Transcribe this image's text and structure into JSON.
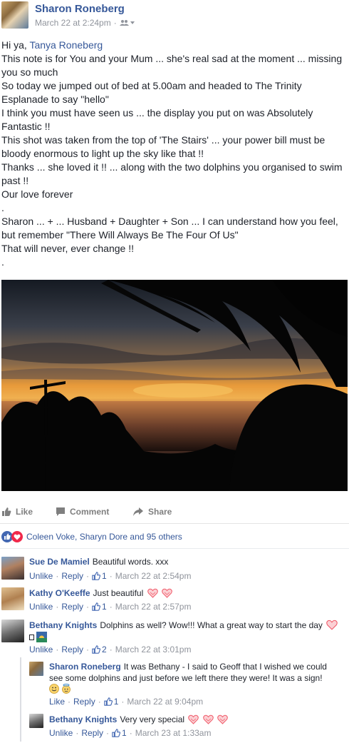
{
  "post": {
    "author": "Sharon Roneberg",
    "date": "March 22 at 2:24pm",
    "audience_icon": "friends-icon",
    "lines": [
      {
        "prefix": "Hi ya, ",
        "mention": "Tanya Roneberg"
      },
      {
        "text": "This note is for You and your Mum ... she's real sad at the moment ... missing"
      },
      {
        "text": "you so much"
      },
      {
        "text": "So today we jumped out of bed at 5.00am and headed to The Trinity"
      },
      {
        "text": "Esplanade to say \"hello\""
      },
      {
        "text": "I think you must have seen us ... the display you put on was Absolutely"
      },
      {
        "text": "Fantastic !!"
      },
      {
        "text": "This shot was taken from the top of 'The Stairs' ... your power bill must be"
      },
      {
        "text": "bloody enormous to light up the sky like that !!"
      },
      {
        "text": "Thanks ... she loved it !! ... along with the two dolphins you organised to swim"
      },
      {
        "text": "past !!"
      },
      {
        "text": "Our love forever"
      },
      {
        "text": "."
      },
      {
        "text": "Sharon ... + ... Husband + Daughter + Son ... I can understand how you feel,"
      },
      {
        "text": "but remember \"There Will Always Be The Four Of Us\""
      },
      {
        "text": "That will never, ever change !!"
      },
      {
        "text": "."
      }
    ]
  },
  "actions": {
    "like": "Like",
    "comment": "Comment",
    "share": "Share"
  },
  "reactions": {
    "summary": "Coleen Voke, Sharyn Dore and 95 others"
  },
  "comments": [
    {
      "name": "Sue De Mamiel",
      "text": "Beautiful words. xxx",
      "hearts": 0,
      "unlike": "Unlike",
      "reply": "Reply",
      "likes": "1",
      "time": "March 22 at 2:54pm"
    },
    {
      "name": "Kathy O'Keeffe",
      "text": "Just beautiful",
      "hearts": 2,
      "unlike": "Unlike",
      "reply": "Reply",
      "likes": "1",
      "time": "March 22 at 2:57pm"
    },
    {
      "name": "Bethany Knights",
      "text": "Dolphins as well? Wow!!! What a great way to start the day",
      "hearts": 1,
      "unlike": "Unlike",
      "reply": "Reply",
      "likes": "2",
      "time": "March 22 at 3:01pm"
    }
  ],
  "replies": [
    {
      "name": "Sharon Roneberg",
      "text1": "It was Bethany - I said to Geoff that I wished we could",
      "text2": "see some dolphins and just before we left there they were! It was a sign!",
      "like": "Like",
      "reply": "Reply",
      "likes": "1",
      "time": "March 22 at 9:04pm"
    },
    {
      "name": "Bethany Knights",
      "text": "Very very special",
      "hearts": 3,
      "unlike": "Unlike",
      "reply": "Reply",
      "likes": "1",
      "time": "March 23 at 1:33am"
    }
  ],
  "colors": {
    "link": "#365899",
    "meta": "#90949c",
    "heart": "#f05a6a",
    "like_blue": "#4267b2"
  }
}
